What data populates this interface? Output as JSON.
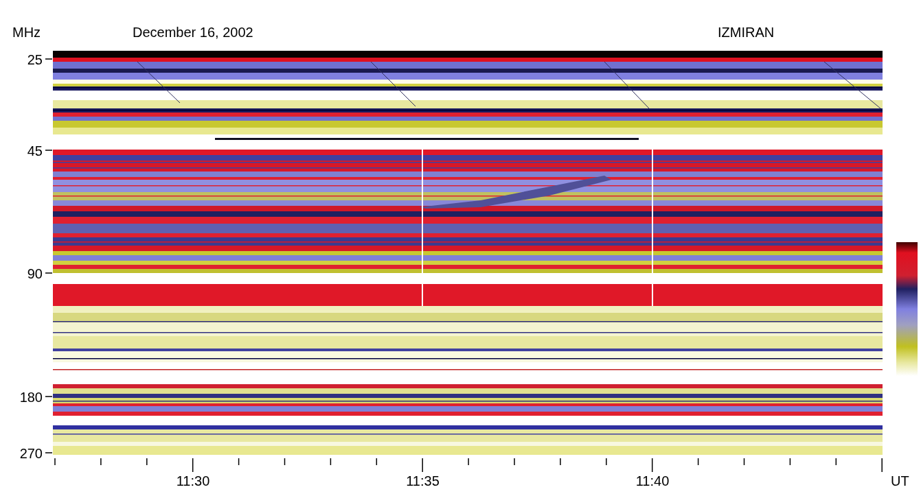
{
  "header": {
    "unit": "MHz",
    "date": "December 16, 2002",
    "station": "IZMIRAN"
  },
  "y_axis": {
    "labels": [
      "25",
      "45",
      "90",
      "180",
      "270"
    ]
  },
  "x_axis": {
    "labels": [
      "11:30",
      "11:35",
      "11:40"
    ],
    "unit": "UT"
  }
}
